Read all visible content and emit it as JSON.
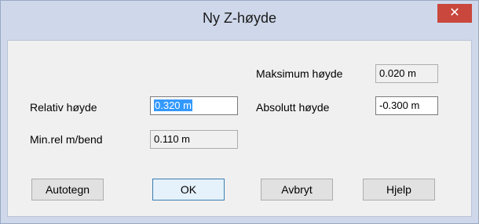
{
  "window": {
    "title": "Ny Z-høyde",
    "close_glyph": "✕"
  },
  "fields": {
    "maksimum": {
      "label": "Maksimum høyde",
      "value": "0.020 m"
    },
    "relativ": {
      "label": "Relativ høyde",
      "value": "0.320 m"
    },
    "absolutt": {
      "label": "Absolutt høyde",
      "value": "-0.300 m"
    },
    "minrel": {
      "label": "Min.rel m/bend",
      "value": "0.110 m"
    }
  },
  "buttons": {
    "autotegn": "Autotegn",
    "ok": "OK",
    "avbryt": "Avbryt",
    "hjelp": "Hjelp"
  },
  "colors": {
    "close": "#c9473c",
    "selection": "#3399ff",
    "frame": "#cfd8ea"
  },
  "icons": {
    "close": "close-icon"
  }
}
